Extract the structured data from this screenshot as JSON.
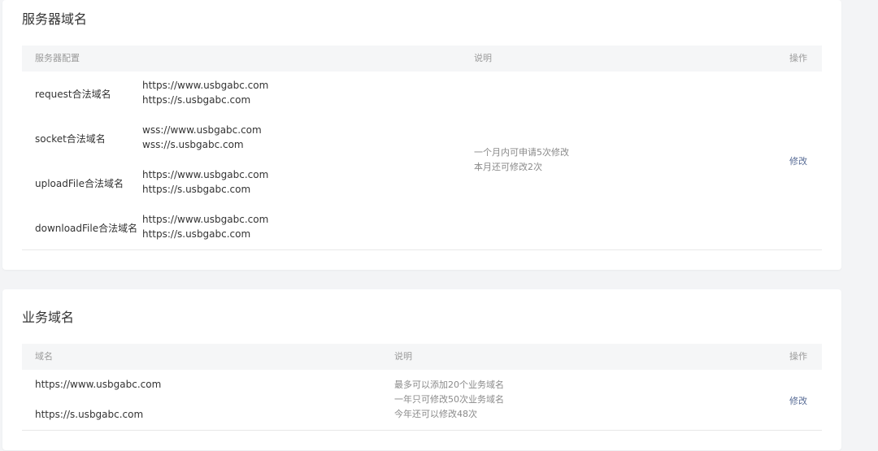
{
  "server_domains": {
    "title": "服务器域名",
    "headers": {
      "config": "服务器配置",
      "desc": "说明",
      "action": "操作"
    },
    "rows": [
      {
        "label": "request合法域名",
        "url1": "https://www.usbgabc.com",
        "url2": "https://s.usbgabc.com"
      },
      {
        "label": "socket合法域名",
        "url1": "wss://www.usbgabc.com",
        "url2": "wss://s.usbgabc.com"
      },
      {
        "label": "uploadFile合法域名",
        "url1": "https://www.usbgabc.com",
        "url2": "https://s.usbgabc.com"
      },
      {
        "label": "downloadFile合法域名",
        "url1": "https://www.usbgabc.com",
        "url2": "https://s.usbgabc.com"
      }
    ],
    "note_line1": "一个月内可申请5次修改",
    "note_line2": "本月还可修改2次",
    "modify_label": "修改"
  },
  "business_domains": {
    "title": "业务域名",
    "headers": {
      "domain": "域名",
      "desc": "说明",
      "action": "操作"
    },
    "items": [
      "https://www.usbgabc.com",
      "https://s.usbgabc.com"
    ],
    "note_line1": "最多可以添加20个业务域名",
    "note_line2": "一年只可修改50次业务域名",
    "note_line3": "今年还可以修改48次",
    "modify_label": "修改"
  }
}
